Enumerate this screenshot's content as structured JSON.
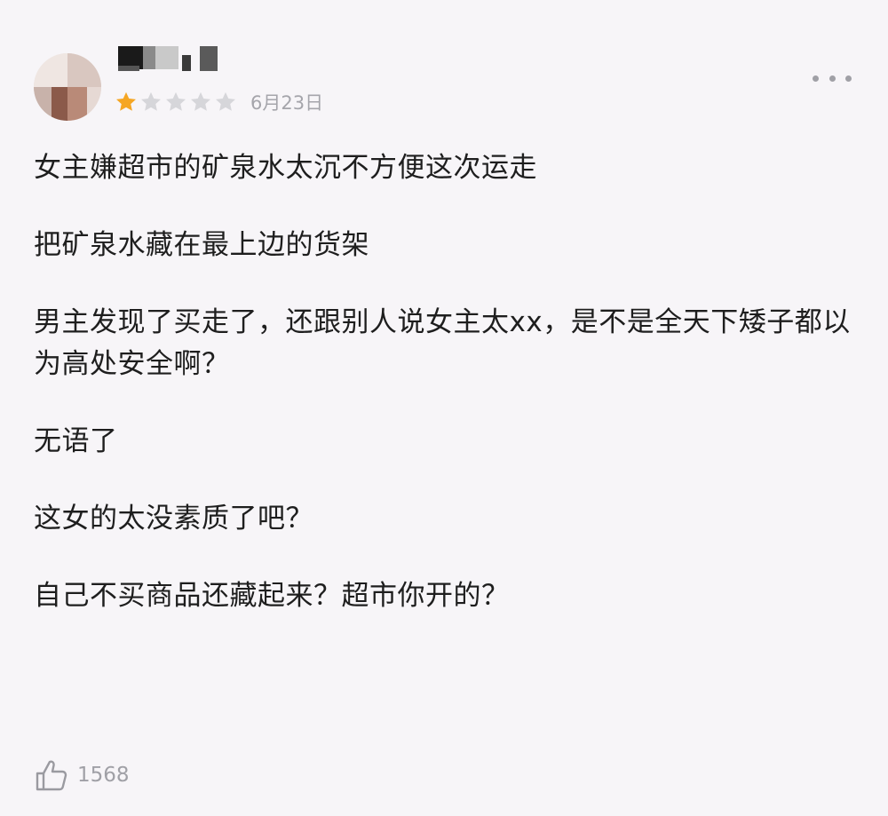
{
  "review": {
    "rating": 1,
    "max_rating": 5,
    "date": "6月23日",
    "paragraphs": [
      "女主嫌超市的矿泉水太沉不方便这次运走",
      "把矿泉水藏在最上边的货架",
      "男主发现了买走了，还跟别人说女主太xx，是不是全天下矮子都以为高处安全啊？",
      "无语了",
      "这女的太没素质了吧？",
      "自己不买商品还藏起来？超市你开的？"
    ],
    "like_count": "1568"
  },
  "icons": {
    "avatar": "avatar-pixelated",
    "username": "username-pixelated",
    "star": "star-icon",
    "more": "more-dots-icon",
    "like": "thumbs-up-icon"
  },
  "colors": {
    "background": "#f7f5f8",
    "star_filled": "#f5a623",
    "star_empty": "#d6d6da",
    "secondary_text": "#a5a5ab"
  }
}
